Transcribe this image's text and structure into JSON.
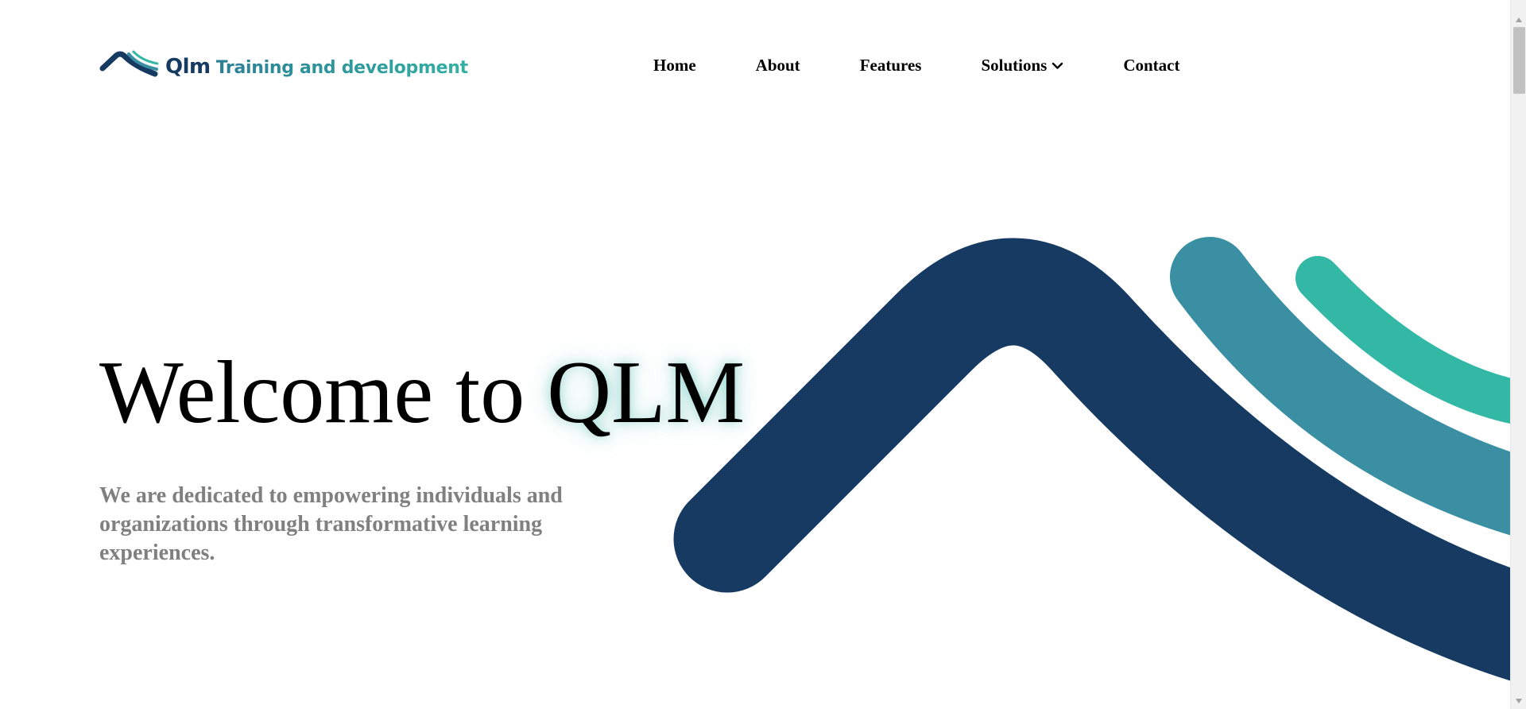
{
  "brand": {
    "name": "Qlm",
    "tagline": "Training and development",
    "logo_icon": "mountain-waves-icon"
  },
  "nav": {
    "items": [
      {
        "label": "Home"
      },
      {
        "label": "About"
      },
      {
        "label": "Features"
      },
      {
        "label": "Solutions",
        "icon": "chevron-down-icon"
      },
      {
        "label": "Contact"
      }
    ]
  },
  "hero": {
    "title_prefix": "Welcome to",
    "title_highlight": "QLM",
    "subtitle": "We are dedicated to empowering individuals and organizations through transformative learning experiences."
  },
  "colors": {
    "navy": "#163a61",
    "teal": "#3a8fa2",
    "mint": "#33b8a6",
    "subtitle_gray": "#808080"
  }
}
